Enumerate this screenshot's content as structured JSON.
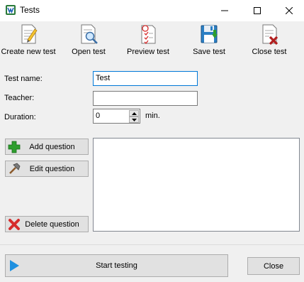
{
  "window": {
    "title": "Tests",
    "app_icon": "test-app-icon",
    "controls": [
      "minimize-icon",
      "maximize-icon",
      "close-icon"
    ]
  },
  "toolbar": {
    "create_label": "Create new test",
    "open_label": "Open test",
    "preview_label": "Preview test",
    "save_label": "Save test",
    "close_label": "Close test"
  },
  "form": {
    "test_name_label": "Test name:",
    "test_name_value": "Test",
    "teacher_label": "Teacher:",
    "teacher_value": "",
    "duration_label": "Duration:",
    "duration_value": "0",
    "duration_unit": "min."
  },
  "questions": {
    "add_label": "Add question",
    "edit_label": "Edit question",
    "delete_label": "Delete question",
    "items": []
  },
  "footer": {
    "start_label": "Start testing",
    "close_label": "Close"
  },
  "colors": {
    "focus_border": "#0078d7",
    "start_arrow": "#1e90e0",
    "add_plus": "#2e9e2e",
    "delete_x": "#d62c2c"
  }
}
